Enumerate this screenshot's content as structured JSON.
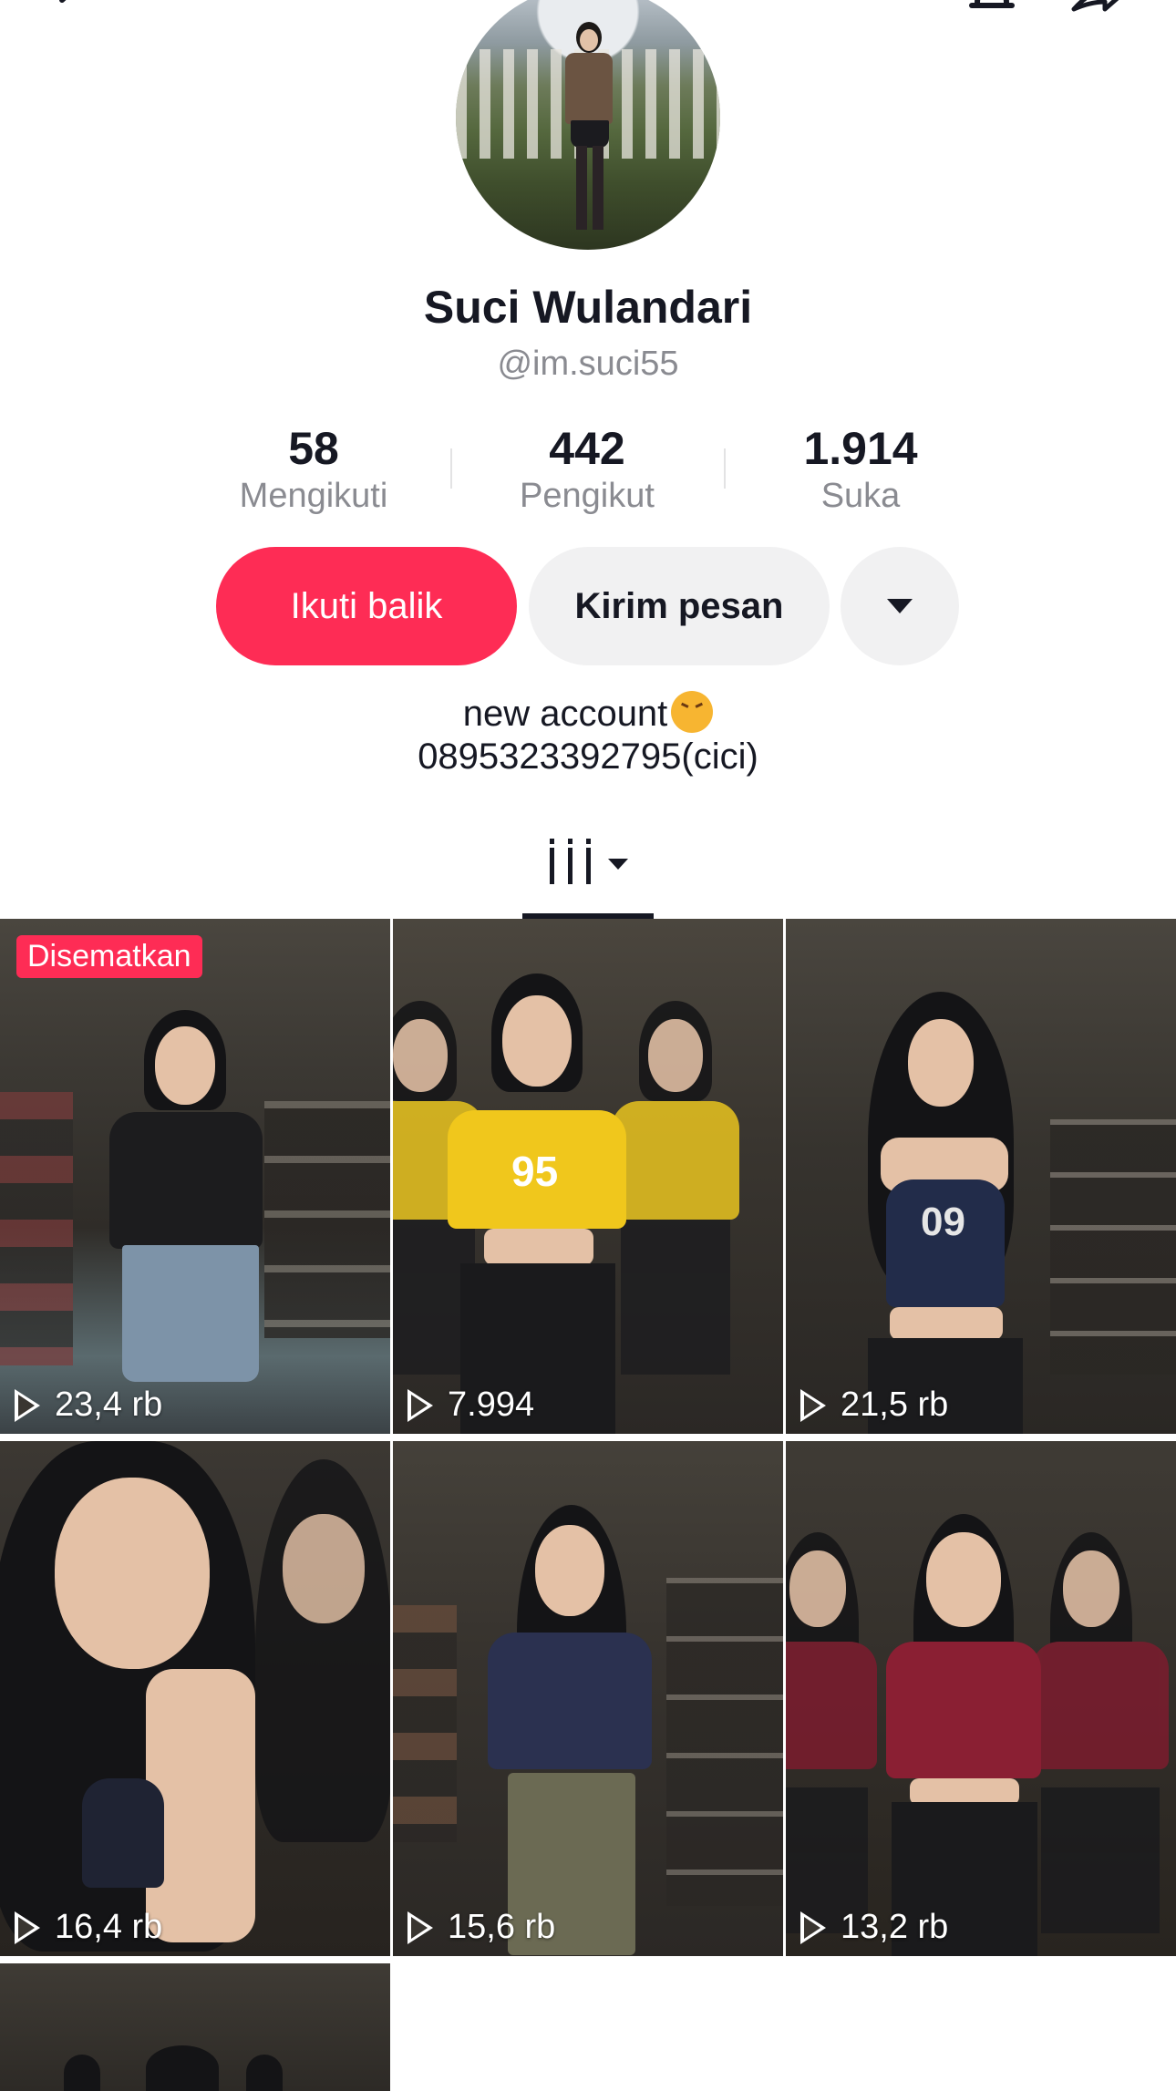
{
  "profile": {
    "display_name": "Suci Wulandari",
    "username": "@im.suci55",
    "stats": [
      {
        "value": "58",
        "label": "Mengikuti"
      },
      {
        "value": "442",
        "label": "Pengikut"
      },
      {
        "value": "1.914",
        "label": "Suka"
      }
    ],
    "bio_line1": "new account",
    "bio_emoji": "confounded-face-emoji",
    "bio_line2": "0895323392795(cici)"
  },
  "actions": {
    "follow_back_label": "Ikuti balik",
    "message_label": "Kirim pesan",
    "more_icon": "caret-down-icon"
  },
  "top_icons": [
    "back-arrow-icon",
    "bell-icon",
    "share-icon"
  ],
  "tabs": {
    "active": "grid-icon"
  },
  "colors": {
    "accent": "#fe2c55",
    "secondary_button": "#f1f1f2",
    "muted_text": "#8a8b91"
  },
  "videos": [
    {
      "views": "23,4 rb",
      "pinned_label": "Disematkan"
    },
    {
      "views": "7.994"
    },
    {
      "views": "21,5 rb"
    },
    {
      "views": "16,4 rb"
    },
    {
      "views": "15,6 rb"
    },
    {
      "views": "13,2 rb"
    }
  ]
}
